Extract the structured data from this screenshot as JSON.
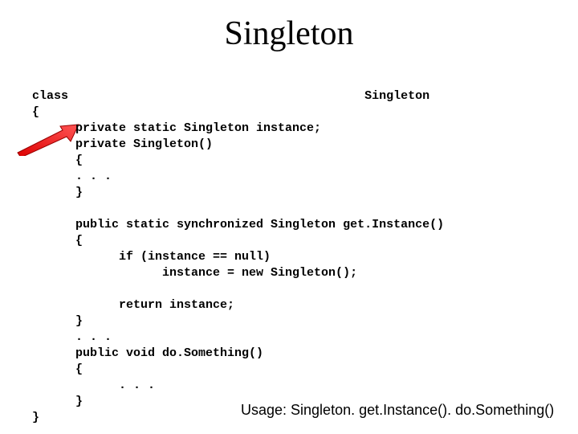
{
  "title": "Singleton",
  "code": {
    "l01": "class                                         Singleton",
    "l02": "{",
    "l03": "      private static Singleton instance;",
    "l04": "      private Singleton()",
    "l05": "      {",
    "l06": "      . . .",
    "l07": "      }",
    "l08": "",
    "l09": "      public static synchronized Singleton get.Instance()",
    "l10": "      {",
    "l11": "            if (instance == null)",
    "l12": "                  instance = new Singleton();",
    "l13": "",
    "l14": "            return instance;",
    "l15": "      }",
    "l16": "      . . .",
    "l17": "      public void do.Something()",
    "l18": "      {",
    "l19": "            . . .",
    "l20": "      }",
    "l21": "}"
  },
  "usage": "Usage: Singleton. get.Instance(). do.Something()"
}
